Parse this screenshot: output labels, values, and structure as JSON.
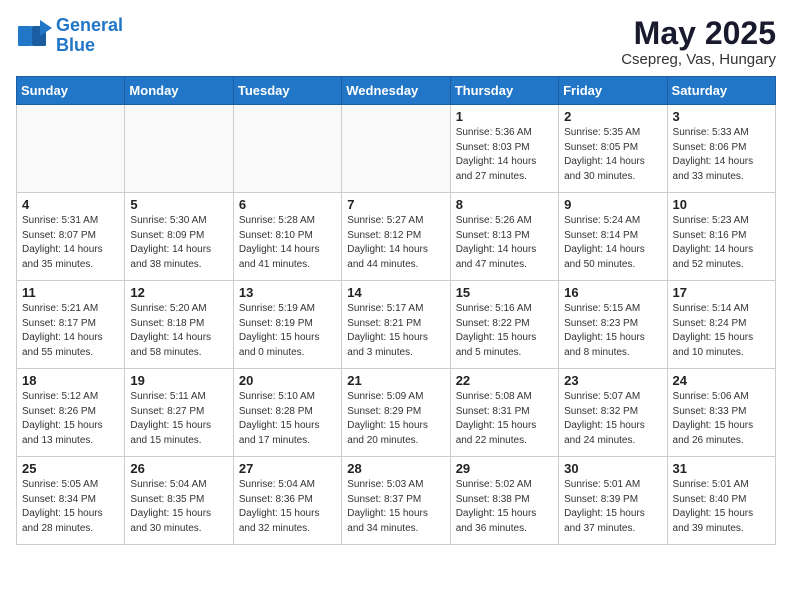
{
  "header": {
    "logo_line1": "General",
    "logo_line2": "Blue",
    "title": "May 2025",
    "subtitle": "Csepreg, Vas, Hungary"
  },
  "weekdays": [
    "Sunday",
    "Monday",
    "Tuesday",
    "Wednesday",
    "Thursday",
    "Friday",
    "Saturday"
  ],
  "weeks": [
    [
      {
        "day": "",
        "info": ""
      },
      {
        "day": "",
        "info": ""
      },
      {
        "day": "",
        "info": ""
      },
      {
        "day": "",
        "info": ""
      },
      {
        "day": "1",
        "info": "Sunrise: 5:36 AM\nSunset: 8:03 PM\nDaylight: 14 hours\nand 27 minutes."
      },
      {
        "day": "2",
        "info": "Sunrise: 5:35 AM\nSunset: 8:05 PM\nDaylight: 14 hours\nand 30 minutes."
      },
      {
        "day": "3",
        "info": "Sunrise: 5:33 AM\nSunset: 8:06 PM\nDaylight: 14 hours\nand 33 minutes."
      }
    ],
    [
      {
        "day": "4",
        "info": "Sunrise: 5:31 AM\nSunset: 8:07 PM\nDaylight: 14 hours\nand 35 minutes."
      },
      {
        "day": "5",
        "info": "Sunrise: 5:30 AM\nSunset: 8:09 PM\nDaylight: 14 hours\nand 38 minutes."
      },
      {
        "day": "6",
        "info": "Sunrise: 5:28 AM\nSunset: 8:10 PM\nDaylight: 14 hours\nand 41 minutes."
      },
      {
        "day": "7",
        "info": "Sunrise: 5:27 AM\nSunset: 8:12 PM\nDaylight: 14 hours\nand 44 minutes."
      },
      {
        "day": "8",
        "info": "Sunrise: 5:26 AM\nSunset: 8:13 PM\nDaylight: 14 hours\nand 47 minutes."
      },
      {
        "day": "9",
        "info": "Sunrise: 5:24 AM\nSunset: 8:14 PM\nDaylight: 14 hours\nand 50 minutes."
      },
      {
        "day": "10",
        "info": "Sunrise: 5:23 AM\nSunset: 8:16 PM\nDaylight: 14 hours\nand 52 minutes."
      }
    ],
    [
      {
        "day": "11",
        "info": "Sunrise: 5:21 AM\nSunset: 8:17 PM\nDaylight: 14 hours\nand 55 minutes."
      },
      {
        "day": "12",
        "info": "Sunrise: 5:20 AM\nSunset: 8:18 PM\nDaylight: 14 hours\nand 58 minutes."
      },
      {
        "day": "13",
        "info": "Sunrise: 5:19 AM\nSunset: 8:19 PM\nDaylight: 15 hours\nand 0 minutes."
      },
      {
        "day": "14",
        "info": "Sunrise: 5:17 AM\nSunset: 8:21 PM\nDaylight: 15 hours\nand 3 minutes."
      },
      {
        "day": "15",
        "info": "Sunrise: 5:16 AM\nSunset: 8:22 PM\nDaylight: 15 hours\nand 5 minutes."
      },
      {
        "day": "16",
        "info": "Sunrise: 5:15 AM\nSunset: 8:23 PM\nDaylight: 15 hours\nand 8 minutes."
      },
      {
        "day": "17",
        "info": "Sunrise: 5:14 AM\nSunset: 8:24 PM\nDaylight: 15 hours\nand 10 minutes."
      }
    ],
    [
      {
        "day": "18",
        "info": "Sunrise: 5:12 AM\nSunset: 8:26 PM\nDaylight: 15 hours\nand 13 minutes."
      },
      {
        "day": "19",
        "info": "Sunrise: 5:11 AM\nSunset: 8:27 PM\nDaylight: 15 hours\nand 15 minutes."
      },
      {
        "day": "20",
        "info": "Sunrise: 5:10 AM\nSunset: 8:28 PM\nDaylight: 15 hours\nand 17 minutes."
      },
      {
        "day": "21",
        "info": "Sunrise: 5:09 AM\nSunset: 8:29 PM\nDaylight: 15 hours\nand 20 minutes."
      },
      {
        "day": "22",
        "info": "Sunrise: 5:08 AM\nSunset: 8:31 PM\nDaylight: 15 hours\nand 22 minutes."
      },
      {
        "day": "23",
        "info": "Sunrise: 5:07 AM\nSunset: 8:32 PM\nDaylight: 15 hours\nand 24 minutes."
      },
      {
        "day": "24",
        "info": "Sunrise: 5:06 AM\nSunset: 8:33 PM\nDaylight: 15 hours\nand 26 minutes."
      }
    ],
    [
      {
        "day": "25",
        "info": "Sunrise: 5:05 AM\nSunset: 8:34 PM\nDaylight: 15 hours\nand 28 minutes."
      },
      {
        "day": "26",
        "info": "Sunrise: 5:04 AM\nSunset: 8:35 PM\nDaylight: 15 hours\nand 30 minutes."
      },
      {
        "day": "27",
        "info": "Sunrise: 5:04 AM\nSunset: 8:36 PM\nDaylight: 15 hours\nand 32 minutes."
      },
      {
        "day": "28",
        "info": "Sunrise: 5:03 AM\nSunset: 8:37 PM\nDaylight: 15 hours\nand 34 minutes."
      },
      {
        "day": "29",
        "info": "Sunrise: 5:02 AM\nSunset: 8:38 PM\nDaylight: 15 hours\nand 36 minutes."
      },
      {
        "day": "30",
        "info": "Sunrise: 5:01 AM\nSunset: 8:39 PM\nDaylight: 15 hours\nand 37 minutes."
      },
      {
        "day": "31",
        "info": "Sunrise: 5:01 AM\nSunset: 8:40 PM\nDaylight: 15 hours\nand 39 minutes."
      }
    ]
  ]
}
